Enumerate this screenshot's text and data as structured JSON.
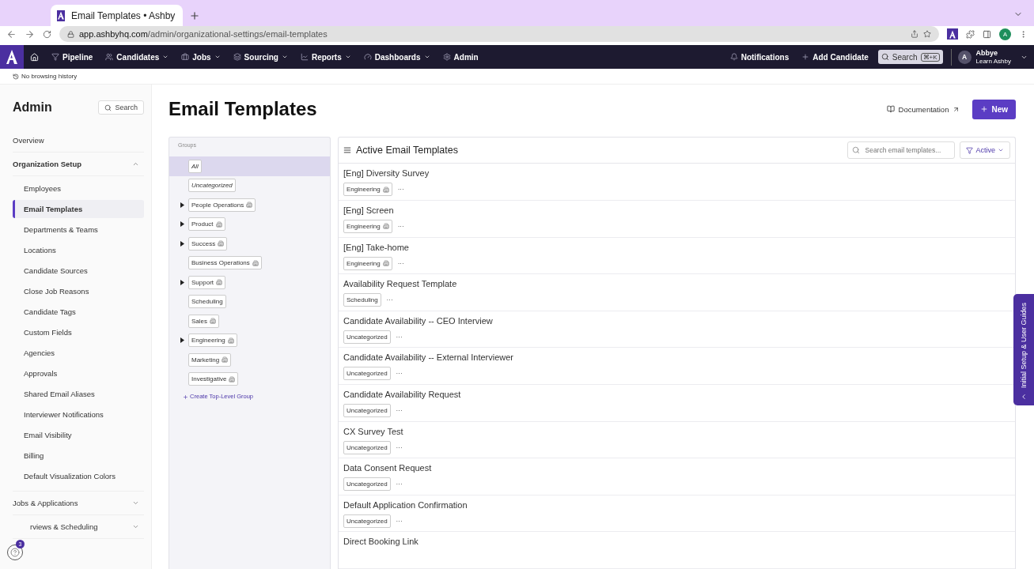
{
  "browser": {
    "tab_title": "Email Templates • Ashby",
    "url_host": "app.ashbyhq.com",
    "url_path": "/admin/organizational-settings/email-templates",
    "profile_initial": "A",
    "history_note": "No browsing history"
  },
  "nav": {
    "items": [
      {
        "label": "Pipeline",
        "has_menu": false
      },
      {
        "label": "Candidates",
        "has_menu": true
      },
      {
        "label": "Jobs",
        "has_menu": true
      },
      {
        "label": "Sourcing",
        "has_menu": true
      },
      {
        "label": "Reports",
        "has_menu": true
      },
      {
        "label": "Dashboards",
        "has_menu": true
      },
      {
        "label": "Admin",
        "has_menu": false
      }
    ],
    "notifications": "Notifications",
    "add_candidate": "Add Candidate",
    "search": "Search",
    "shortcut": "⌘+K",
    "user_initial": "A",
    "user_name": "Abbye",
    "user_org": "Learn Ashby"
  },
  "sidebar": {
    "title": "Admin",
    "search": "Search",
    "sections": [
      {
        "label": "Overview",
        "expandable": false,
        "expanded": false
      },
      {
        "label": "Organization Setup",
        "expandable": true,
        "expanded": true,
        "children": [
          {
            "label": "Employees",
            "selected": false
          },
          {
            "label": "Email Templates",
            "selected": true
          },
          {
            "label": "Departments & Teams",
            "selected": false
          },
          {
            "label": "Locations",
            "selected": false
          },
          {
            "label": "Candidate Sources",
            "selected": false
          },
          {
            "label": "Close Job Reasons",
            "selected": false
          },
          {
            "label": "Candidate Tags",
            "selected": false
          },
          {
            "label": "Custom Fields",
            "selected": false
          },
          {
            "label": "Agencies",
            "selected": false
          },
          {
            "label": "Approvals",
            "selected": false
          },
          {
            "label": "Shared Email Aliases",
            "selected": false
          },
          {
            "label": "Interviewer Notifications",
            "selected": false
          },
          {
            "label": "Email Visibility",
            "selected": false
          },
          {
            "label": "Billing",
            "selected": false
          },
          {
            "label": "Default Visualization Colors",
            "selected": false
          }
        ]
      },
      {
        "label": "Jobs & Applications",
        "expandable": true,
        "expanded": false
      },
      {
        "label": "rviews & Scheduling",
        "expandable": true,
        "expanded": false
      }
    ],
    "help_badge": "3"
  },
  "page": {
    "title": "Email Templates",
    "documentation": "Documentation",
    "new_button": "New"
  },
  "groups": {
    "heading": "Groups",
    "items": [
      {
        "label": "All",
        "selected": true,
        "expandable": false,
        "shared": false,
        "italic": true
      },
      {
        "label": "Uncategorized",
        "selected": false,
        "expandable": false,
        "shared": false,
        "italic": true
      },
      {
        "label": "People Operations",
        "selected": false,
        "expandable": true,
        "shared": true,
        "italic": false
      },
      {
        "label": "Product",
        "selected": false,
        "expandable": true,
        "shared": true,
        "italic": false
      },
      {
        "label": "Success",
        "selected": false,
        "expandable": true,
        "shared": true,
        "italic": false
      },
      {
        "label": "Business Operations",
        "selected": false,
        "expandable": false,
        "shared": true,
        "italic": false
      },
      {
        "label": "Support",
        "selected": false,
        "expandable": true,
        "shared": true,
        "italic": false
      },
      {
        "label": "Scheduling",
        "selected": false,
        "expandable": false,
        "shared": false,
        "italic": false
      },
      {
        "label": "Sales",
        "selected": false,
        "expandable": false,
        "shared": true,
        "italic": false
      },
      {
        "label": "Engineering",
        "selected": false,
        "expandable": true,
        "shared": true,
        "italic": false
      },
      {
        "label": "Marketing",
        "selected": false,
        "expandable": false,
        "shared": true,
        "italic": false
      },
      {
        "label": "Investigative",
        "selected": false,
        "expandable": false,
        "shared": true,
        "italic": false
      }
    ],
    "create": "Create Top-Level Group"
  },
  "templates": {
    "heading": "Active Email Templates",
    "search_placeholder": "Search email templates...",
    "filter": "Active",
    "rows": [
      {
        "title": "[Eng] Diversity Survey",
        "tag": "Engineering",
        "shared": true,
        "more": "···"
      },
      {
        "title": "[Eng] Screen",
        "tag": "Engineering",
        "shared": true,
        "more": "···"
      },
      {
        "title": "[Eng] Take-home",
        "tag": "Engineering",
        "shared": true,
        "more": "···"
      },
      {
        "title": "Availability Request Template",
        "tag": "Scheduling",
        "shared": false,
        "more": "···"
      },
      {
        "title": "Candidate Availability -- CEO Interview",
        "tag": "Uncategorized",
        "shared": false,
        "more": "···"
      },
      {
        "title": "Candidate Availability -- External Interviewer",
        "tag": "Uncategorized",
        "shared": false,
        "more": "···"
      },
      {
        "title": "Candidate Availability Request",
        "tag": "Uncategorized",
        "shared": false,
        "more": "···"
      },
      {
        "title": "CX Survey Test",
        "tag": "Uncategorized",
        "shared": false,
        "more": "···"
      },
      {
        "title": "Data Consent Request",
        "tag": "Uncategorized",
        "shared": false,
        "more": "···"
      },
      {
        "title": "Default Application Confirmation",
        "tag": "Uncategorized",
        "shared": false,
        "more": "···"
      },
      {
        "title": "Direct Booking Link"
      }
    ]
  },
  "guide_tab": "Initial Setup & User Guides"
}
